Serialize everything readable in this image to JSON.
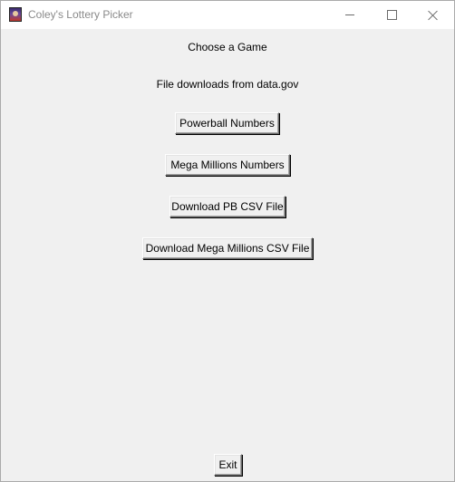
{
  "window": {
    "title": "Coley's Lottery Picker"
  },
  "main": {
    "heading": "Choose a Game",
    "subheading": "File downloads from data.gov",
    "buttons": {
      "powerball": "Powerball Numbers",
      "mega_millions": "Mega Millions Numbers",
      "download_pb": "Download PB CSV File",
      "download_mm": "Download Mega Millions CSV File",
      "exit": "Exit"
    }
  },
  "icons": {
    "app": "app-icon",
    "minimize": "minimize-icon",
    "maximize": "maximize-icon",
    "close": "close-icon"
  }
}
